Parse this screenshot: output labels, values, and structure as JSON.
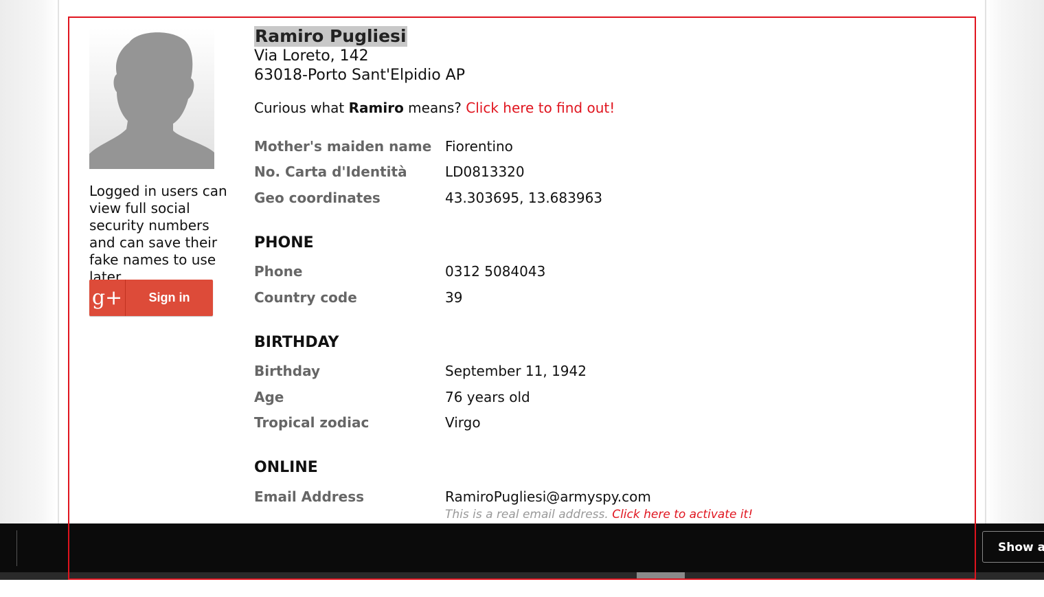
{
  "profile": {
    "name": "Ramiro Pugliesi",
    "address_line1": "Via Loreto, 142",
    "address_line2": "63018-Porto Sant'Elpidio AP",
    "curious_prefix": "Curious what ",
    "first_name": "Ramiro",
    "curious_suffix": " means? ",
    "curious_link": "Click here to find out!"
  },
  "sidebar": {
    "login_note": "Logged in users can view full social security numbers and can save their fake names to use later.",
    "signin_label": "Sign in",
    "signin_icon": "g+",
    "signin_color": "#dd4b39"
  },
  "details": [
    {
      "label": "Mother's maiden name",
      "value": "Fiorentino"
    },
    {
      "label": "No. Carta d'Identità",
      "value": "LD0813320"
    },
    {
      "label": "Geo coordinates",
      "value": "43.303695, 13.683963"
    }
  ],
  "phone": {
    "heading": "PHONE",
    "rows": [
      {
        "label": "Phone",
        "value": "0312 5084043"
      },
      {
        "label": "Country code",
        "value": "39"
      }
    ]
  },
  "birthday": {
    "heading": "BIRTHDAY",
    "rows": [
      {
        "label": "Birthday",
        "value": "September 11, 1942"
      },
      {
        "label": "Age",
        "value": "76 years old"
      },
      {
        "label": "Tropical zodiac",
        "value": "Virgo"
      }
    ]
  },
  "online": {
    "heading": "ONLINE",
    "email_label": "Email Address",
    "email_value": "RamiroPugliesi@armyspy.com",
    "email_note": "This is a real email address. ",
    "email_note_link": "Click here to activate it!"
  },
  "taskbar": {
    "show_all": "Show all"
  },
  "colors": {
    "accent": "#e0141e",
    "label_gray": "#666666",
    "taskbar": "#0b0b0b"
  }
}
